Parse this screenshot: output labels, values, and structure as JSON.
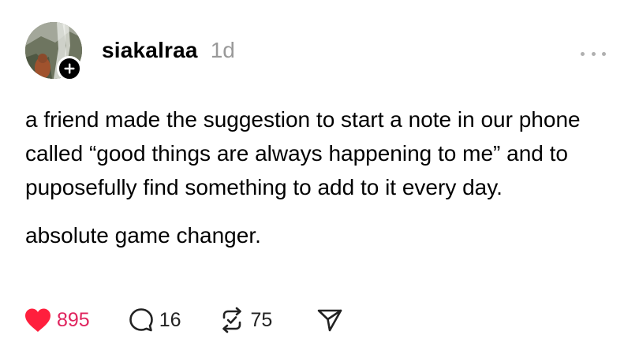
{
  "post": {
    "username": "siakalraa",
    "timestamp": "1d",
    "paragraphs": [
      "a friend made the suggestion to start a note in our phone called “good things are always happening to me” and to puposefully find something to add to it every day.",
      "absolute game changer."
    ]
  },
  "actions": {
    "likes": "895",
    "replies": "16",
    "reposts": "75"
  },
  "icons": {
    "like": "heart-icon",
    "reply": "speech-bubble-icon",
    "repost": "repost-icon",
    "share": "send-icon",
    "more": "more-dots-icon",
    "follow": "plus-icon"
  },
  "colors": {
    "like_active": "#e0245e",
    "timestamp": "#999999",
    "text": "#000000"
  }
}
